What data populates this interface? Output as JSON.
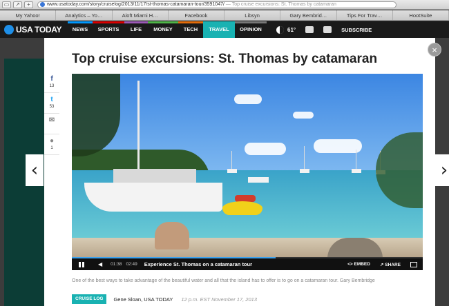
{
  "browser": {
    "url": "www.usatoday.com/story/cruiselog/2013/11/17/st-thomas-catamaran-tour/3591047/",
    "url_suffix": " — Top cruise excursions: St. Thomas by catamaran",
    "bookmarks": [
      "My Yahoo!",
      "Analytics – Yo…",
      "Aloft Miami H…",
      "Facebook",
      "Libsyn",
      "Gary Bembrid…",
      "Tips For Trav…",
      "HootSuite"
    ]
  },
  "site": {
    "logo": "USA TODAY",
    "nav": [
      {
        "label": "NEWS",
        "color": "#0098fe"
      },
      {
        "label": "SPORTS",
        "color": "#d90000"
      },
      {
        "label": "LIFE",
        "color": "#9b59b6"
      },
      {
        "label": "MONEY",
        "color": "#4fb548"
      },
      {
        "label": "TECH",
        "color": "#e36c09"
      },
      {
        "label": "TRAVEL",
        "color": "#19b2b2"
      },
      {
        "label": "OPINION",
        "color": "#777777"
      }
    ],
    "temperature": "61°",
    "subscribe": "SUBSCRIBE"
  },
  "article": {
    "title": "Top cruise excursions: St. Thomas by catamaran",
    "close_symbol": "×",
    "prev_symbol": "‹",
    "next_symbol": "›",
    "share": [
      {
        "icon": "facebook-icon",
        "glyph": "f",
        "color": "#3b5998",
        "count": "13"
      },
      {
        "icon": "twitter-icon",
        "glyph": "t",
        "color": "#1da1f2",
        "count": "53"
      },
      {
        "icon": "email-icon",
        "glyph": "✉",
        "color": "#888888",
        "count": ""
      },
      {
        "icon": "comment-icon",
        "glyph": "●",
        "color": "#888888",
        "count": "1"
      }
    ],
    "video": {
      "time_current": "01:38",
      "time_total": "02:49",
      "progress": 0.58,
      "title": "Experience St. Thomas on a catamaran tour",
      "embed": "EMBED",
      "share": "SHARE"
    },
    "caption": "One of the best ways to take advantage of the beautiful water and all that the island has to offer is to go on a catamaran tour. Gary Bembridge",
    "category": "CRUISE LOG",
    "author": "Gene Sloan, USA TODAY",
    "date": "12 p.m. EST November 17, 2013"
  }
}
